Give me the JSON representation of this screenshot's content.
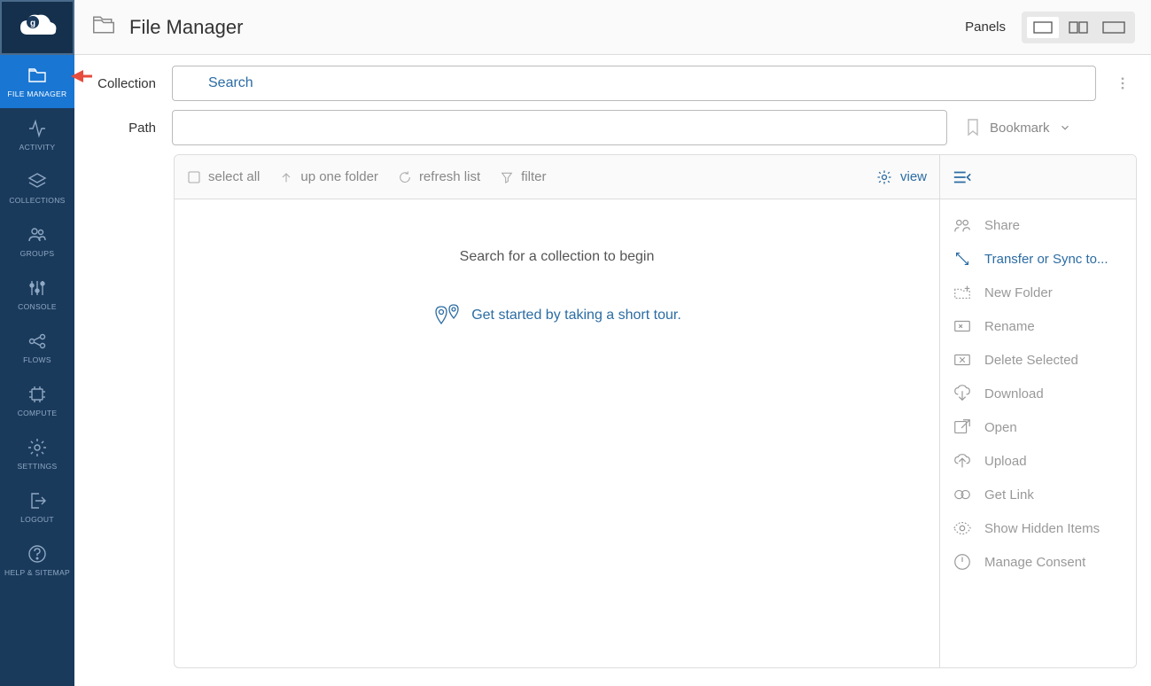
{
  "app": {
    "title": "File Manager",
    "panels_label": "Panels"
  },
  "nav": {
    "items": [
      {
        "label": "FILE MANAGER"
      },
      {
        "label": "ACTIVITY"
      },
      {
        "label": "COLLECTIONS"
      },
      {
        "label": "GROUPS"
      },
      {
        "label": "CONSOLE"
      },
      {
        "label": "FLOWS"
      },
      {
        "label": "COMPUTE"
      },
      {
        "label": "SETTINGS"
      },
      {
        "label": "LOGOUT"
      },
      {
        "label": "HELP & SITEMAP"
      }
    ]
  },
  "fields": {
    "collection_label": "Collection",
    "path_label": "Path",
    "search_placeholder": "Search",
    "bookmark_label": "Bookmark"
  },
  "toolbar": {
    "select_all": "select all",
    "up_one": "up one folder",
    "refresh": "refresh list",
    "filter": "filter",
    "view": "view"
  },
  "body": {
    "empty": "Search for a collection to begin",
    "tour": "Get started by taking a short tour."
  },
  "actions": {
    "items": [
      {
        "label": "Share",
        "enabled": false
      },
      {
        "label": "Transfer or Sync to...",
        "enabled": true
      },
      {
        "label": "New Folder",
        "enabled": false
      },
      {
        "label": "Rename",
        "enabled": false
      },
      {
        "label": "Delete Selected",
        "enabled": false
      },
      {
        "label": "Download",
        "enabled": false
      },
      {
        "label": "Open",
        "enabled": false
      },
      {
        "label": "Upload",
        "enabled": false
      },
      {
        "label": "Get Link",
        "enabled": false
      },
      {
        "label": "Show Hidden Items",
        "enabled": false
      },
      {
        "label": "Manage Consent",
        "enabled": false
      }
    ]
  }
}
